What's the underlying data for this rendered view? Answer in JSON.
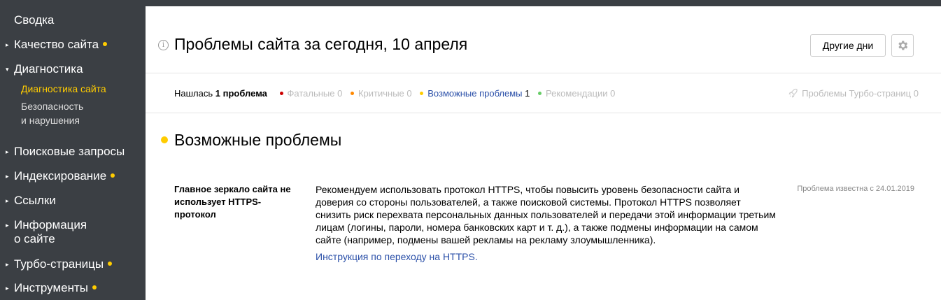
{
  "sidebar": {
    "summary": "Сводка",
    "items": [
      {
        "label": "Качество сайта",
        "arrow": "▸"
      },
      {
        "label": "Диагностика",
        "arrow": "▾"
      },
      {
        "label": "Поисковые запросы",
        "arrow": "▸"
      },
      {
        "label": "Индексирование",
        "arrow": "▸"
      },
      {
        "label": "Ссылки",
        "arrow": "▸"
      },
      {
        "label": "Информация",
        "label2": "о сайте",
        "arrow": "▸"
      },
      {
        "label": "Турбо-страницы",
        "arrow": "▸"
      },
      {
        "label": "Инструменты",
        "arrow": "▸"
      }
    ],
    "sub": {
      "diag_site": "Диагностика сайта",
      "security_line1": "Безопасность",
      "security_line2": "и нарушения"
    },
    "accent_color": "#ffcc00"
  },
  "header": {
    "info_icon": "i",
    "title": "Проблемы сайта за сегодня, 10 апреля",
    "other_days": "Другие дни",
    "settings_icon": "gear-icon"
  },
  "filters": {
    "found_prefix": "Нашлась",
    "found_count": "1 проблема",
    "fatal": {
      "label": "Фатальные",
      "count": "0",
      "color": "#cc0000"
    },
    "critical": {
      "label": "Критичные",
      "count": "0",
      "color": "#ff8800"
    },
    "possible": {
      "label": "Возможные проблемы",
      "count": "1",
      "color": "#ffcc00"
    },
    "recommend": {
      "label": "Рекомендации",
      "count": "0",
      "color": "#66cc66"
    },
    "turbo": {
      "label": "Проблемы Турбо-страниц",
      "count": "0"
    }
  },
  "section": {
    "title": "Возможные проблемы"
  },
  "problem": {
    "name": "Главное зеркало сайта не использует HTTPS-протокол",
    "description": "Рекомендуем использовать протокол HTTPS, чтобы повысить уровень безопасности сайта и доверия со стороны пользователей, а также поисковой системы. Протокол HTTPS позволяет снизить риск перехвата персональных данных пользователей и передачи этой информации третьим лицам (логины, пароли, номера банковских карт и т. д.), а также подмены информации на самом сайте (например, подмены вашей рекламы на рекламу злоумышленника).",
    "link": "Инструкция по переходу на HTTPS.",
    "known": "Проблема известна с 24.01.2019"
  }
}
